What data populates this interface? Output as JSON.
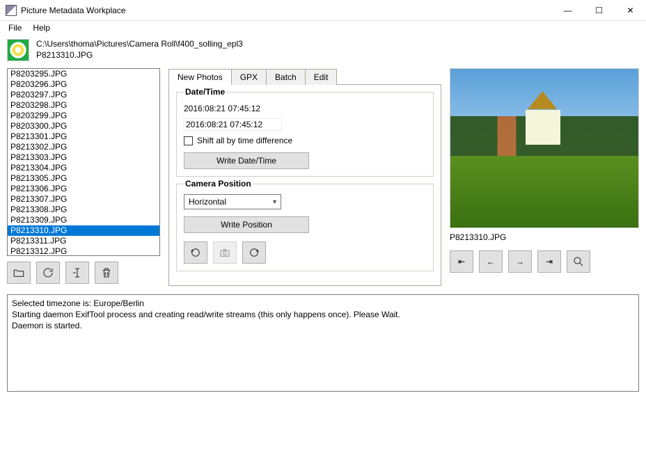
{
  "window": {
    "title": "Picture Metadata Workplace"
  },
  "menu": {
    "file": "File",
    "help": "Help"
  },
  "path": {
    "dir": "C:\\Users\\thoma\\Pictures\\Camera Roll\\f400_solling_epl3",
    "file": "P8213310.JPG"
  },
  "files": [
    "P8203295.JPG",
    "P8203296.JPG",
    "P8203297.JPG",
    "P8203298.JPG",
    "P8203299.JPG",
    "P8203300.JPG",
    "P8213301.JPG",
    "P8213302.JPG",
    "P8213303.JPG",
    "P8213304.JPG",
    "P8213305.JPG",
    "P8213306.JPG",
    "P8213307.JPG",
    "P8213308.JPG",
    "P8213309.JPG",
    "P8213310.JPG",
    "P8213311.JPG",
    "P8213312.JPG"
  ],
  "selectedIndex": 15,
  "tabs": {
    "newphotos": "New Photos",
    "gpx": "GPX",
    "batch": "Batch",
    "edit": "Edit"
  },
  "datetime": {
    "title": "Date/Time",
    "readValue": "2016:08:21 07:45:12",
    "editValue": "2016:08:21 07:45:12",
    "shiftLabel": "Shift all by time difference",
    "writeBtn": "Write Date/Time"
  },
  "camerapos": {
    "title": "Camera Position",
    "selected": "Horizontal",
    "writeBtn": "Write Position"
  },
  "preview": {
    "filename": "P8213310.JPG"
  },
  "log": {
    "l1": "Selected timezone is: Europe/Berlin",
    "l2": "Starting daemon ExifTool process and creating read/write streams (this only happens once). Please Wait.",
    "l3": "Daemon is started."
  },
  "icons": {
    "min": "—",
    "max": "☐",
    "close": "✕",
    "navFirst": "⇤",
    "navPrev": "←",
    "navNext": "→",
    "navLast": "⇥"
  }
}
